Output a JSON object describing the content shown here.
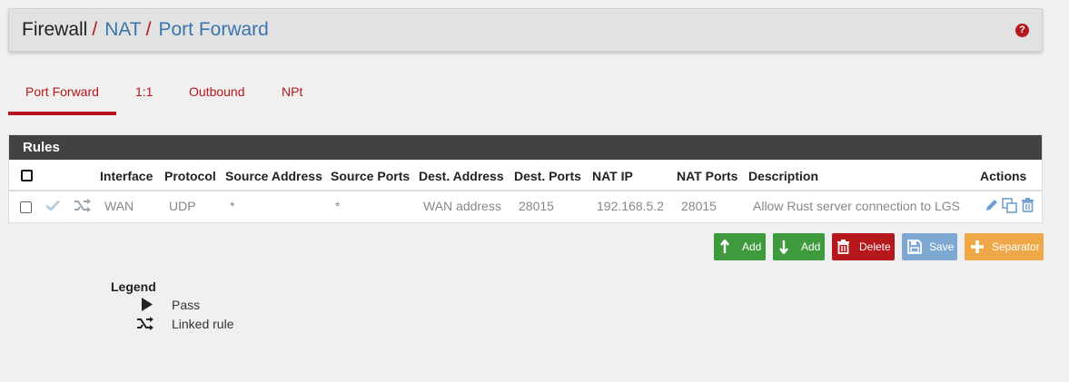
{
  "breadcrumb": {
    "root": "Firewall",
    "nat": "NAT",
    "current": "Port Forward",
    "separator": "/"
  },
  "help_icon": "question-circle-icon",
  "tabs": [
    {
      "label": "Port Forward",
      "active": true
    },
    {
      "label": "1:1",
      "active": false
    },
    {
      "label": "Outbound",
      "active": false
    },
    {
      "label": "NPt",
      "active": false
    }
  ],
  "panel": {
    "title": "Rules",
    "columns": [
      "Interface",
      "Protocol",
      "Source Address",
      "Source Ports",
      "Dest. Address",
      "Dest. Ports",
      "NAT IP",
      "NAT Ports",
      "Description",
      "Actions"
    ],
    "rows": [
      {
        "interface": "WAN",
        "protocol": "UDP",
        "source_address": "*",
        "source_ports": "*",
        "dest_address": "WAN address",
        "dest_ports": "28015",
        "nat_ip": "192.168.5.2",
        "nat_ports": "28015",
        "description": "Allow Rust server connection to LGS",
        "status_icons": [
          "check-icon",
          "shuffle-icon"
        ],
        "action_icons": [
          "pencil-icon",
          "copy-icon",
          "trash-icon"
        ]
      }
    ]
  },
  "buttons": [
    {
      "label": "Add",
      "icon": "arrow-up-icon",
      "color": "#3d9a3d"
    },
    {
      "label": "Add",
      "icon": "arrow-down-icon",
      "color": "#3d9a3d"
    },
    {
      "label": "Delete",
      "icon": "trash-icon",
      "color": "#b5171b"
    },
    {
      "label": "Save",
      "icon": "save-icon",
      "color": "#7ea8d1"
    },
    {
      "label": "Separator",
      "icon": "plus-icon",
      "color": "#efa847"
    }
  ],
  "legend": {
    "title": "Legend",
    "items": [
      {
        "label": "Pass",
        "icon": "play-icon"
      },
      {
        "label": "Linked rule",
        "icon": "shuffle-icon"
      }
    ]
  },
  "colors": {
    "accent": "#b5171b",
    "link": "#3a75b0",
    "panel_header": "#424242"
  }
}
